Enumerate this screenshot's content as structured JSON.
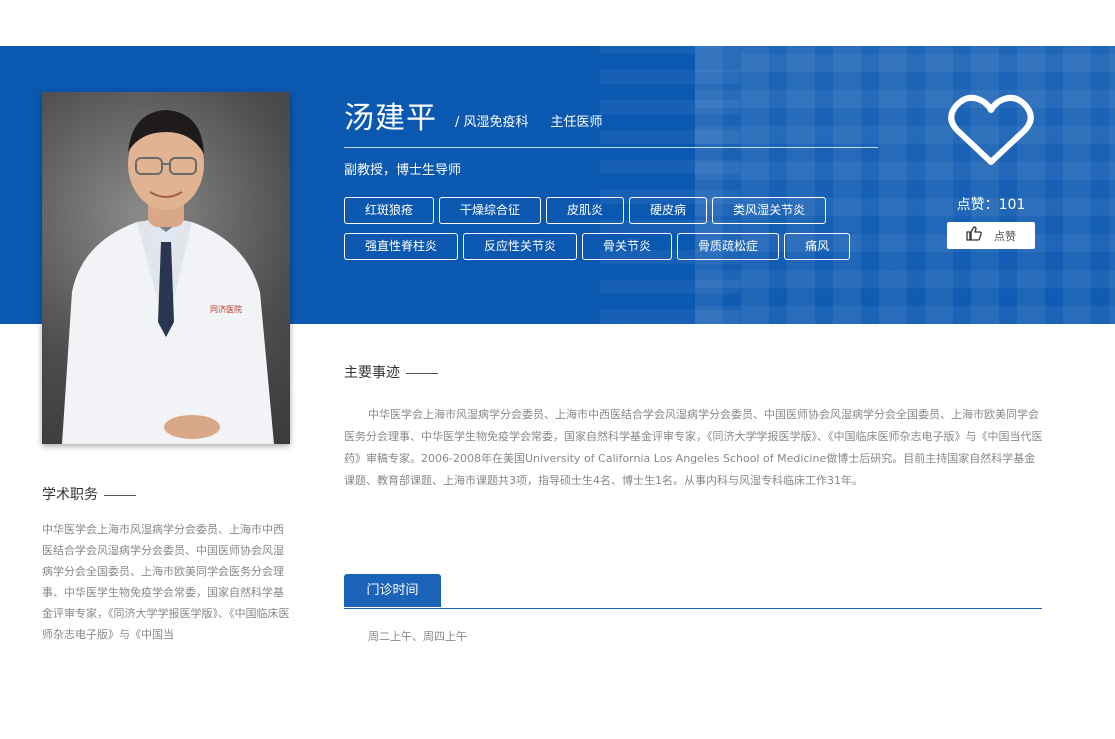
{
  "doctor": {
    "name": "汤建平",
    "department": "/ 风湿免疫科",
    "position": "主任医师",
    "subtitle": "副教授，博士生导师",
    "tags": [
      "红斑狼疮",
      "干燥综合征",
      "皮肌炎",
      "硬皮病",
      "类风湿关节炎",
      "强直性脊柱炎",
      "反应性关节炎",
      "骨关节炎",
      "骨质疏松症",
      "痛风"
    ]
  },
  "likes": {
    "count_text": "点赞：101",
    "button_label": "点赞"
  },
  "academic": {
    "title": "学术职务",
    "text": "中华医学会上海市风湿病学分会委员、上海市中西医结合学会风湿病学分会委员、中国医师协会风湿病学分会全国委员、上海市欧美同学会医务分会理事、中华医学生物免疫学会常委，国家自然科学基金评审专家，《同济大学学报医学版》、《中国临床医师杂志电子版》与《中国当"
  },
  "achievements": {
    "title": "主要事迹",
    "text": "中华医学会上海市风湿病学分会委员、上海市中西医结合学会风湿病学分会委员、中国医师协会风湿病学分会全国委员、上海市欧美同学会医务分会理事、中华医学生物免疫学会常委，国家自然科学基金评审专家，《同济大学学报医学版》、《中国临床医师杂志电子版》与《中国当代医药》审稿专家。2006-2008年在美国University of California Los Angeles School of Medicine做博士后研究。目前主持国家自然科学基金课题、教育部课题、上海市课题共3项，指导硕士生4名、博士生1名。从事内科与风湿专科临床工作31年。"
  },
  "clinic": {
    "tab_label": "门诊时间",
    "hours": "周二上午、周四上午"
  },
  "colors": {
    "brand_blue": "#0b58b1",
    "tab_blue": "#1b63b8"
  },
  "icons": [
    "heart-icon",
    "thumbs-up-icon"
  ]
}
